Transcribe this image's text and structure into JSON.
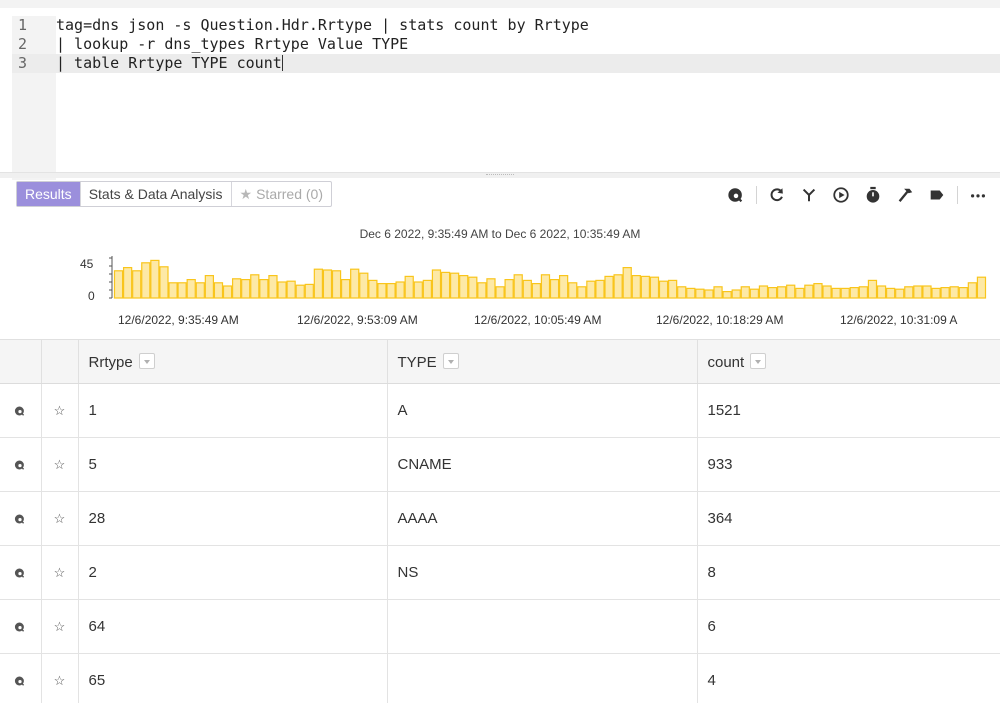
{
  "editor": {
    "lines": [
      {
        "number": "1",
        "text": "tag=dns json -s Question.Hdr.Rrtype | stats count by Rrtype"
      },
      {
        "number": "2",
        "text": "| lookup -r dns_types Rrtype Value TYPE"
      },
      {
        "number": "3",
        "text": "| table Rrtype TYPE count"
      }
    ]
  },
  "tabs": [
    {
      "label": "Results",
      "state": "active"
    },
    {
      "label": "Stats & Data Analysis",
      "state": "normal"
    },
    {
      "label": "Starred (0)",
      "state": "disabled",
      "icon": "star-icon"
    }
  ],
  "toolbar": [
    "explore-icon",
    "refresh-icon",
    "fork-icon",
    "play-icon",
    "timer-icon",
    "hammer-icon",
    "label-icon",
    "more-icon"
  ],
  "timeline": {
    "range_label": "Dec 6 2022, 9:35:49 AM to Dec 6 2022, 10:35:49 AM",
    "y_ticks": [
      "45",
      "0"
    ],
    "x_ticks": [
      "12/6/2022, 9:35:49 AM",
      "12/6/2022, 9:53:09 AM",
      "12/6/2022, 10:05:49 AM",
      "12/6/2022, 10:18:29 AM",
      "12/6/2022, 10:31:09 A"
    ],
    "bar_color": "#f9c51c",
    "bar_fill": "#fde9a6"
  },
  "chart_data": {
    "type": "bar",
    "ylim": [
      0,
      50
    ],
    "y_ticks": [
      45,
      0
    ],
    "values": [
      34,
      38,
      34,
      44,
      47,
      39,
      19,
      19,
      23,
      19,
      28,
      19,
      15,
      24,
      23,
      29,
      23,
      28,
      20,
      21,
      16,
      17,
      36,
      35,
      34,
      23,
      36,
      31,
      22,
      18,
      18,
      20,
      27,
      20,
      22,
      35,
      32,
      31,
      28,
      26,
      19,
      24,
      14,
      23,
      29,
      22,
      18,
      29,
      23,
      28,
      19,
      14,
      21,
      22,
      27,
      29,
      38,
      28,
      27,
      26,
      21,
      22,
      14,
      12,
      11,
      10,
      14,
      8,
      10,
      14,
      11,
      15,
      13,
      14,
      16,
      12,
      16,
      18,
      15,
      12,
      12,
      13,
      14,
      22,
      15,
      12,
      11,
      14,
      15,
      15,
      12,
      13,
      14,
      13,
      19,
      26
    ]
  },
  "table": {
    "columns": [
      "Rrtype",
      "TYPE",
      "count"
    ],
    "rows": [
      {
        "Rrtype": "1",
        "TYPE": "A",
        "count": "1521"
      },
      {
        "Rrtype": "5",
        "TYPE": "CNAME",
        "count": "933"
      },
      {
        "Rrtype": "28",
        "TYPE": "AAAA",
        "count": "364"
      },
      {
        "Rrtype": "2",
        "TYPE": "NS",
        "count": "8"
      },
      {
        "Rrtype": "64",
        "TYPE": "",
        "count": "6"
      },
      {
        "Rrtype": "65",
        "TYPE": "",
        "count": "4"
      }
    ]
  }
}
